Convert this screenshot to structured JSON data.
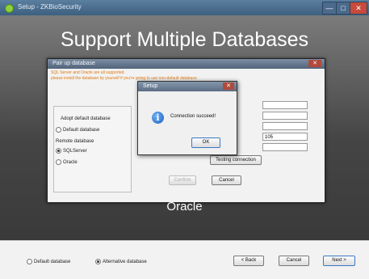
{
  "window": {
    "title": "Setup - ZKBioSecurity",
    "controls": {
      "minimize": "—",
      "maximize": "□",
      "close": "✕"
    }
  },
  "banner": {
    "heading": "Support Multiple Databases",
    "caption": "Oracle"
  },
  "pair_dialog": {
    "title": "Pair up database",
    "close": "✕",
    "notes": [
      "SQL Server and Oracle are all supported.",
      "please install the database by yourself if you're going to use non-default database."
    ],
    "adopt_label": "Adopt default database",
    "default_db": "Default database",
    "remote_label": "Remote database",
    "sqlserver": "SQLServer",
    "oracle": "Oracle",
    "fields": [
      "",
      "",
      "",
      "105",
      ""
    ],
    "test_button": "Testing connection",
    "confirm_button": "Confirm",
    "cancel_button": "Cancel"
  },
  "message_box": {
    "title": "Setup",
    "close": "✕",
    "icon": "info-icon",
    "text": "Connection succeed!",
    "ok": "OK"
  },
  "footer": {
    "default_option": "Default database",
    "alternative_option": "Alternative database",
    "selected": "alternative",
    "back": "< Back",
    "cancel": "Cancel",
    "next": "Next >"
  }
}
